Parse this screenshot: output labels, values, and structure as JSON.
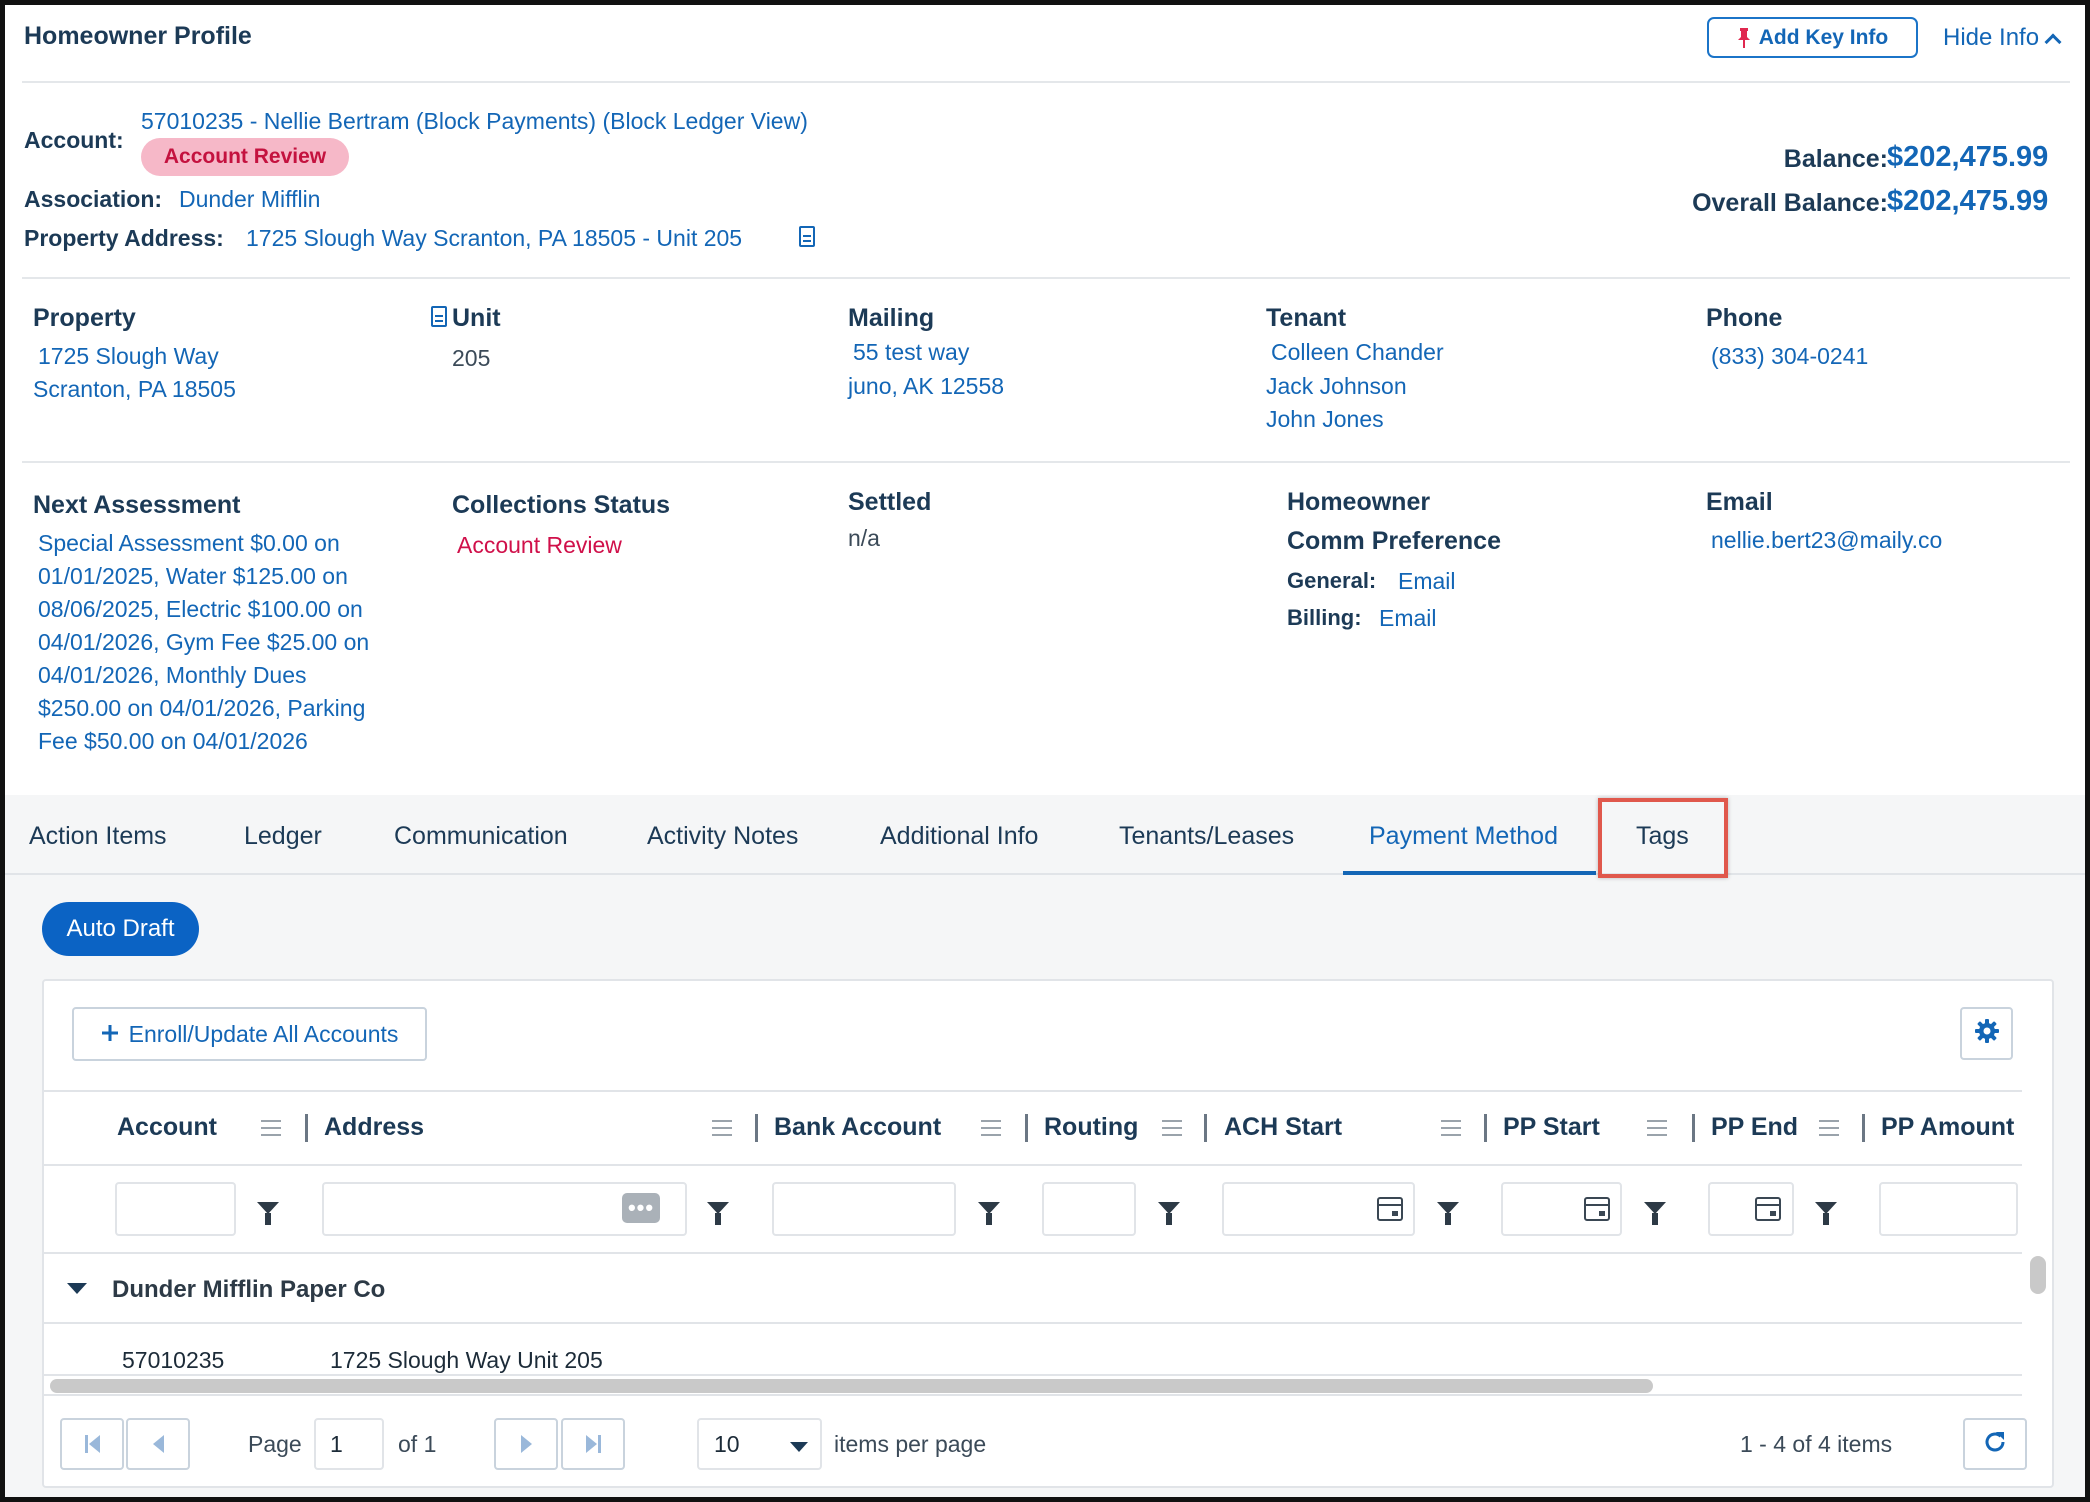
{
  "header": {
    "title": "Homeowner Profile",
    "add_key_info_label": "Add Key Info",
    "hide_info_label": "Hide Info"
  },
  "account": {
    "account_label": "Account:",
    "account_value": "57010235 - Nellie Bertram (Block Payments) (Block Ledger View)",
    "status_badge": "Account Review",
    "association_label": "Association:",
    "association_value": "Dunder Mifflin",
    "property_address_label": "Property Address:",
    "property_address_value": "1725 Slough Way Scranton, PA 18505 - Unit 205",
    "balance_label": "Balance:",
    "balance_value": "$202,475.99",
    "overall_balance_label": "Overall Balance:",
    "overall_balance_value": "$202,475.99"
  },
  "details": {
    "property": {
      "heading": "Property",
      "line1": "1725 Slough Way",
      "line2": "Scranton, PA 18505"
    },
    "unit": {
      "heading": "Unit",
      "value": "205"
    },
    "mailing": {
      "heading": "Mailing",
      "line1": "55 test way",
      "line2": "juno, AK 12558"
    },
    "tenant": {
      "heading": "Tenant",
      "names": [
        "Colleen Chander",
        "Jack Johnson",
        "John Jones"
      ]
    },
    "phone": {
      "heading": "Phone",
      "value": "(833) 304-0241"
    },
    "next_assessment": {
      "heading": "Next Assessment",
      "lines": [
        "Special Assessment $0.00 on",
        "01/01/2025, Water $125.00 on",
        "08/06/2025, Electric $100.00 on",
        "04/01/2026, Gym Fee $25.00 on",
        "04/01/2026, Monthly Dues",
        "$250.00 on 04/01/2026, Parking",
        "Fee $50.00 on 04/01/2026"
      ]
    },
    "collections_status": {
      "heading": "Collections Status",
      "value": "Account Review"
    },
    "settled": {
      "heading": "Settled",
      "value": "n/a"
    },
    "comm_pref": {
      "heading_line1": "Homeowner",
      "heading_line2": "Comm Preference",
      "general_label": "General:",
      "general_value": "Email",
      "billing_label": "Billing:",
      "billing_value": "Email"
    },
    "email": {
      "heading": "Email",
      "value": "nellie.bert23@maily.co"
    }
  },
  "tabs": [
    {
      "label": "Action Items"
    },
    {
      "label": "Ledger"
    },
    {
      "label": "Communication"
    },
    {
      "label": "Activity Notes"
    },
    {
      "label": "Additional Info"
    },
    {
      "label": "Tenants/Leases"
    },
    {
      "label": "Payment Method"
    },
    {
      "label": "Tags"
    }
  ],
  "active_tab": "Payment Method",
  "payment": {
    "auto_draft_label": "Auto Draft",
    "enroll_label": "Enroll/Update All Accounts"
  },
  "grid": {
    "columns": [
      "Account",
      "Address",
      "Bank Account",
      "Routing",
      "ACH Start",
      "PP Start",
      "PP End",
      "PP Amount"
    ],
    "group_label": "Dunder Mifflin Paper Co",
    "rows": [
      {
        "account": "57010235",
        "address": "1725 Slough Way Unit 205"
      }
    ]
  },
  "pager": {
    "page_label": "Page",
    "page_value": "1",
    "of_label": "of 1",
    "page_size": "10",
    "items_per_page_label": "items per page",
    "summary": "1 - 4 of 4 items"
  },
  "colors": {
    "accent": "#1366b6",
    "primary_button": "#0b63c4",
    "badge_bg": "#f6b8c8",
    "badge_text": "#c4123f",
    "highlight": "#e0584c"
  }
}
